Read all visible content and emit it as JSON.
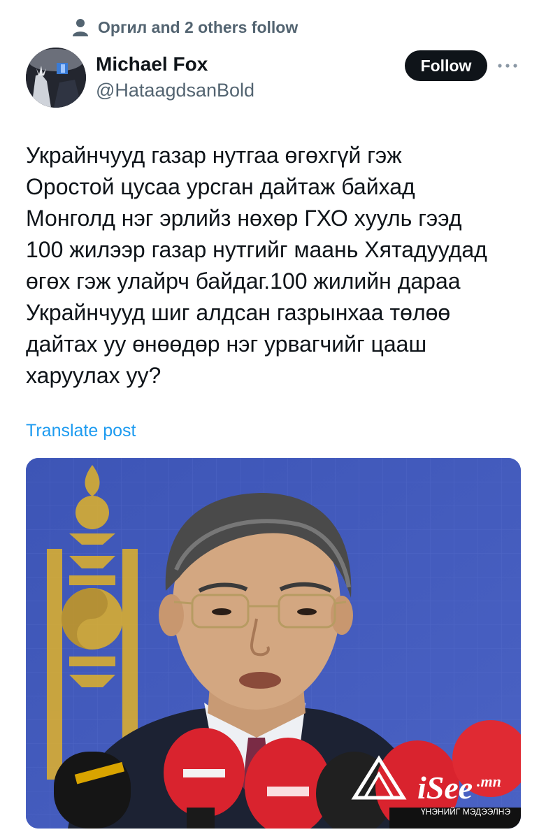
{
  "social_context": {
    "icon": "person-icon",
    "text": "Оргил and 2 others follow"
  },
  "author": {
    "name": "Michael Fox",
    "handle": "@HataagdsanBold",
    "avatar_icon": "avatar-image"
  },
  "actions": {
    "follow_label": "Follow",
    "more_icon": "more-horizontal-icon"
  },
  "post": {
    "text": "Украйнчууд газар нутгаа өгөхгүй гэж\nОростой цусаа урсган дайтаж байхад\nМонголд нэг эрлийз нөхөр ГХО хууль гээд\n100 жилээр газар нутгийг маань Хятадуудад\nөгөх гэж улайрч байдаг.100 жилийн дараа\nУкрайнчууд шиг алдсан газрынхаа төлөө\nдайтах уу өнөөдөр нэг урвагчийг цааш\nхаруулах уу?",
    "translate_label": "Translate post"
  },
  "media": {
    "watermark_brand": "iSee",
    "watermark_suffix": ".mn",
    "watermark_tagline": "ҮНЭНИЙГ МЭДЭЭЛНЭ",
    "colors": {
      "background": "#3f58b8",
      "emblem": "#e0b22a",
      "microphone": "#d9232e"
    }
  },
  "colors": {
    "text": "#0f1419",
    "secondary": "#536471",
    "link": "#1d9bf0",
    "button": "#0f1419"
  }
}
